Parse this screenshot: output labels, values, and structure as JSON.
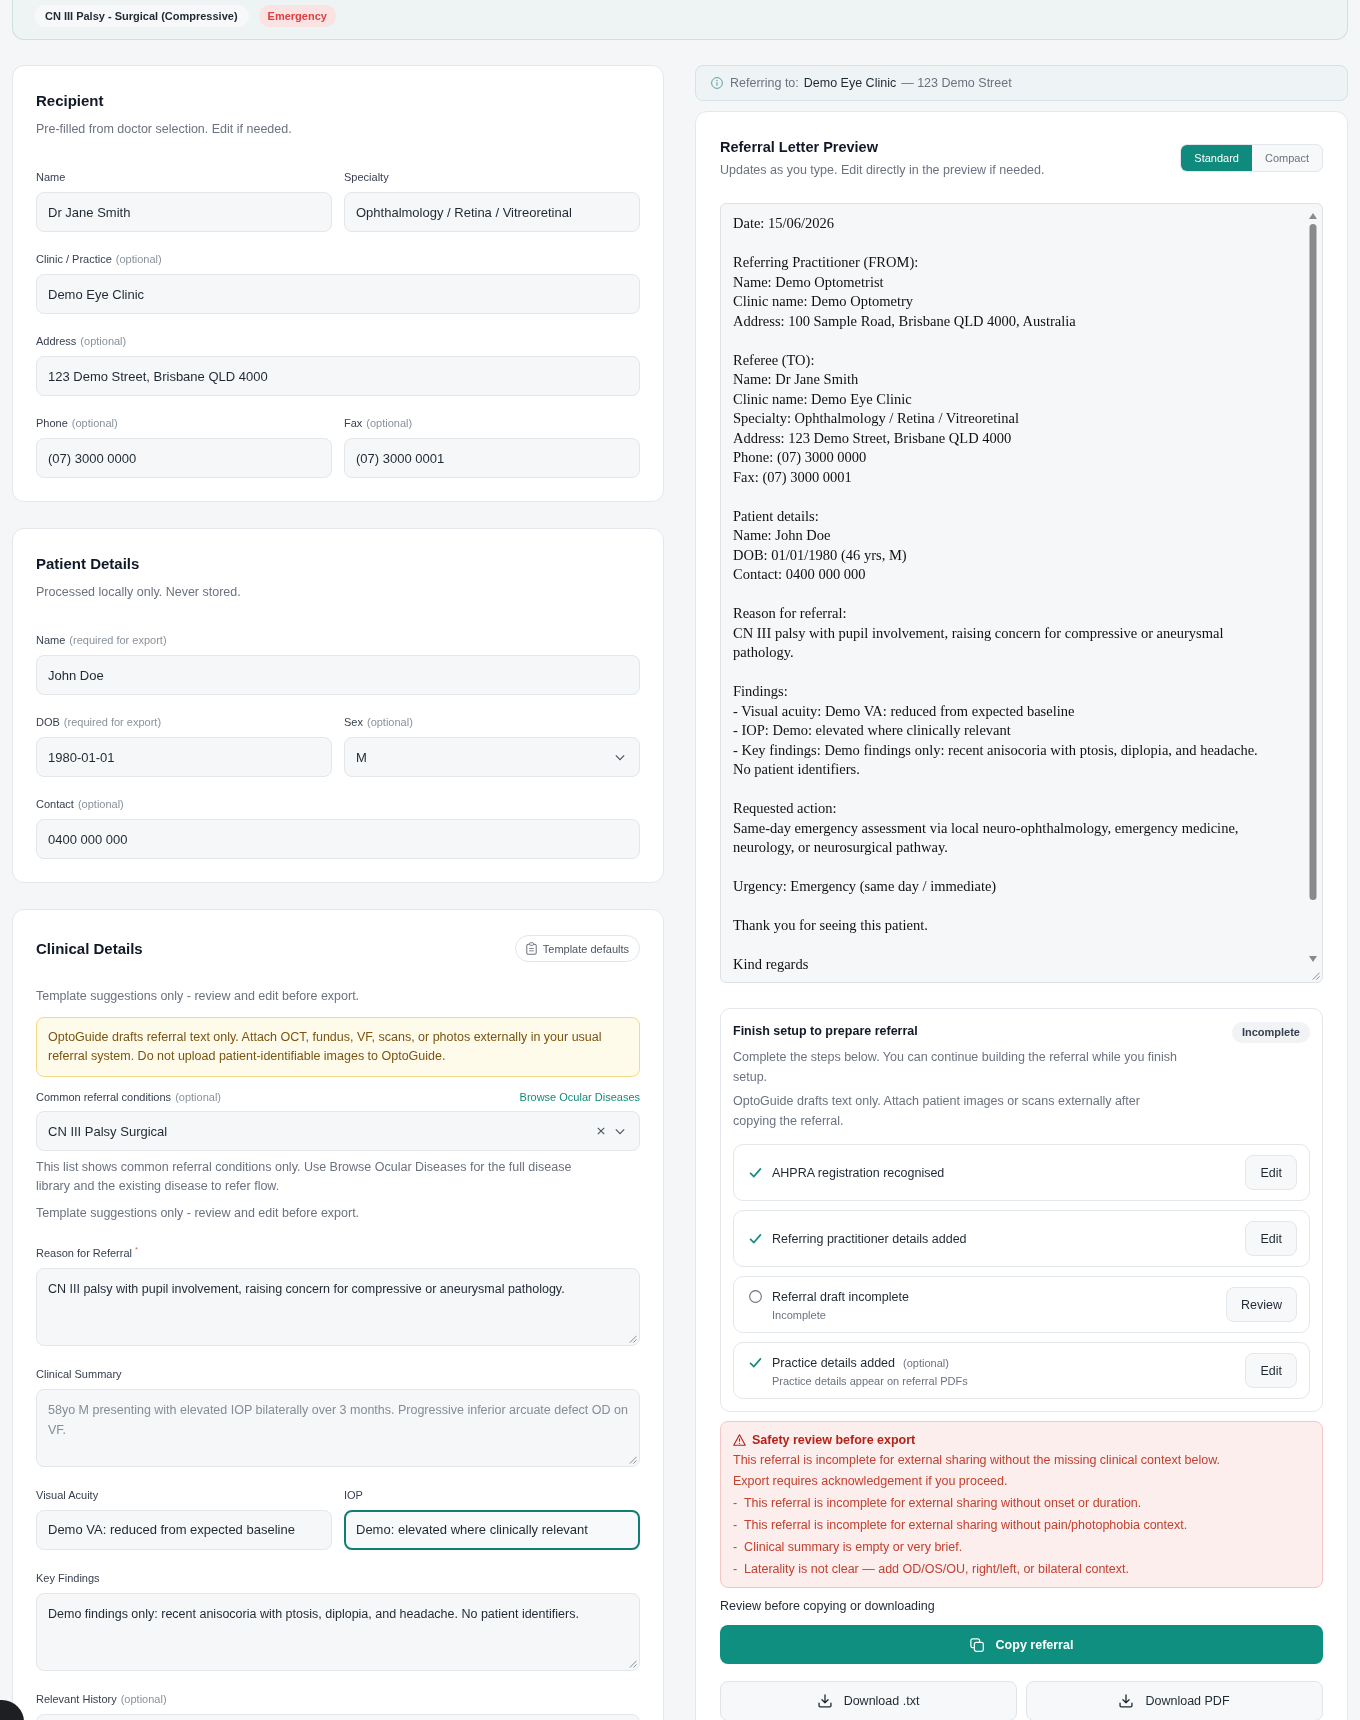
{
  "header": {
    "condition": "CN III Palsy - Surgical (Compressive)",
    "urgency": "Emergency"
  },
  "recipient": {
    "title": "Recipient",
    "subtitle": "Pre-filled from doctor selection. Edit if needed.",
    "rows": [
      {
        "fields": [
          {
            "kind": "text",
            "label": "Name",
            "value": "Dr Jane Smith",
            "focused": false
          },
          {
            "kind": "text",
            "label": "Specialty",
            "value": "Ophthalmology / Retina / Vitreoretinal",
            "focused": false
          }
        ]
      },
      {
        "fields": [
          {
            "kind": "text",
            "label": "Clinic / Practice",
            "hint": "(optional)",
            "value": "Demo Eye Clinic",
            "focused": false
          }
        ]
      },
      {
        "fields": [
          {
            "kind": "text",
            "label": "Address",
            "hint": "(optional)",
            "value": "123 Demo Street, Brisbane QLD 4000",
            "focused": false
          }
        ]
      },
      {
        "fields": [
          {
            "kind": "text",
            "label": "Phone",
            "hint": "(optional)",
            "value": "(07) 3000 0000",
            "focused": false
          },
          {
            "kind": "text",
            "label": "Fax",
            "hint": "(optional)",
            "value": "(07) 3000 0001",
            "focused": false
          }
        ]
      }
    ]
  },
  "patient": {
    "title": "Patient Details",
    "subtitle": "Processed locally only. Never stored.",
    "rows": [
      {
        "fields": [
          {
            "kind": "text",
            "label": "Name",
            "hint": "(required for export)",
            "value": "John Doe",
            "focused": false
          }
        ]
      },
      {
        "fields": [
          {
            "kind": "text",
            "label": "DOB",
            "hint": "(required for export)",
            "value": "1980-01-01",
            "focused": false
          },
          {
            "kind": "select",
            "label": "Sex",
            "hint": "(optional)",
            "value": "M",
            "focused": false
          }
        ]
      },
      {
        "fields": [
          {
            "kind": "text",
            "label": "Contact",
            "hint": "(optional)",
            "value": "0400 000 000",
            "focused": false
          }
        ]
      }
    ]
  },
  "clinical": {
    "title": "Clinical Details",
    "template_button": "Template defaults",
    "intro": "Template suggestions only - review and edit before export.",
    "notice": "OptoGuide drafts referral text only. Attach OCT, fundus, VF, scans, or photos externally in your usual referral system. Do not upload patient-identifiable images to OptoGuide.",
    "condition": {
      "label": "Common referral conditions",
      "hint": "(optional)",
      "link": "Browse Ocular Diseases",
      "value": "CN III Palsy Surgical",
      "clearable": true,
      "help": "This list shows common referral conditions only. Use Browse Ocular Diseases for the full disease library and the existing disease to refer flow.",
      "note": "Template suggestions only - review and edit before export."
    },
    "rows": [
      {
        "fields": [
          {
            "kind": "textarea",
            "label": "Reason for Referral $^{*}$",
            "value": "CN III palsy with pupil involvement, raising concern for compressive or aneurysmal pathology.",
            "focused": false
          }
        ]
      },
      {
        "fields": [
          {
            "kind": "textarea",
            "label": "Clinical Summary",
            "placeholder": "58yo M presenting with elevated IOP bilaterally over 3 months. Progressive inferior arcuate defect OD on VF.",
            "focused": false
          }
        ]
      },
      {
        "fields": [
          {
            "kind": "text",
            "label": "Visual Acuity",
            "value": "Demo VA: reduced from expected baseline",
            "focused": false
          },
          {
            "kind": "text",
            "label": "IOP",
            "value": "Demo: elevated where clinically relevant",
            "focused": true
          }
        ]
      },
      {
        "fields": [
          {
            "kind": "textarea",
            "label": "Key Findings",
            "value": "Demo findings only: recent anisocoria with ptosis, diplopia, and headache. No patient identifiers.",
            "focused": false
          }
        ]
      },
      {
        "fields": [
          {
            "kind": "textarea",
            "label": "Relevant History",
            "hint": "(optional)",
            "focused": false
          }
        ]
      }
    ]
  },
  "referring": {
    "label": "Referring to:",
    "clinic": "Demo Eye Clinic",
    "address": "— 123 Demo Street"
  },
  "preview": {
    "title": "Referral Letter Preview",
    "subtitle": "Updates as you type. Edit directly in the preview if needed.",
    "modes": [
      {
        "label": "Standard",
        "selected": true
      },
      {
        "label": "Compact",
        "selected": false
      }
    ],
    "letter": "Date: 15/06/2026\n\nReferring Practitioner (FROM):\nName: Demo Optometrist\nClinic name: Demo Optometry\nAddress: 100 Sample Road, Brisbane QLD 4000, Australia\n\nReferee (TO):\nName: Dr Jane Smith\nClinic name: Demo Eye Clinic\nSpecialty: Ophthalmology / Retina / Vitreoretinal\nAddress: 123 Demo Street, Brisbane QLD 4000\nPhone: (07) 3000 0000\nFax: (07) 3000 0001\n\nPatient details:\nName: John Doe\nDOB: 01/01/1980 (46 yrs, M)\nContact: 0400 000 000\n\nReason for referral:\nCN III palsy with pupil involvement, raising concern for compressive or aneurysmal\npathology.\n\nFindings:\n- Visual acuity: Demo VA: reduced from expected baseline\n- IOP: Demo: elevated where clinically relevant\n- Key findings: Demo findings only: recent anisocoria with ptosis, diplopia, and headache.\nNo patient identifiers.\n\nRequested action:\nSame-day emergency assessment via local neuro-ophthalmology, emergency medicine,\nneurology, or neurosurgical pathway.\n\nUrgency: Emergency (same day / immediate)\n\nThank you for seeing this patient.\n\nKind regards"
  },
  "setup": {
    "title": "Finish setup to prepare referral",
    "status": "Incomplete",
    "paragraphs": [
      "Complete the steps below. You can continue building the referral while you finish setup.",
      "OptoGuide drafts text only. Attach patient images or scans externally after copying the referral."
    ],
    "steps": [
      {
        "label": "AHPRA registration recognised",
        "done": true,
        "action": "Edit"
      },
      {
        "label": "Referring practitioner details added",
        "done": true,
        "action": "Edit"
      },
      {
        "label": "Referral draft incomplete",
        "done": false,
        "status": "Incomplete",
        "action": "Review"
      },
      {
        "label": "Practice details added",
        "tag": "(optional)",
        "done": true,
        "note": "Practice details appear on referral PDFs",
        "action": "Edit"
      }
    ]
  },
  "safety": {
    "title": "Safety review before export",
    "intro": [
      "This referral is incomplete for external sharing without the missing clinical context below.",
      "Export requires acknowledgement if you proceed."
    ],
    "issues": [
      "-  This referral is incomplete for external sharing without onset or duration.",
      "-  This referral is incomplete for external sharing without pain/photophobia context.",
      "-  Clinical summary is empty or very brief.",
      "-  Laterality is not clear — add OD/OS/OU, right/left, or bilateral context."
    ]
  },
  "export": {
    "note": "Review before copying or downloading",
    "copy": "Copy referral",
    "downloads": [
      "Download .txt",
      "Download PDF"
    ]
  }
}
